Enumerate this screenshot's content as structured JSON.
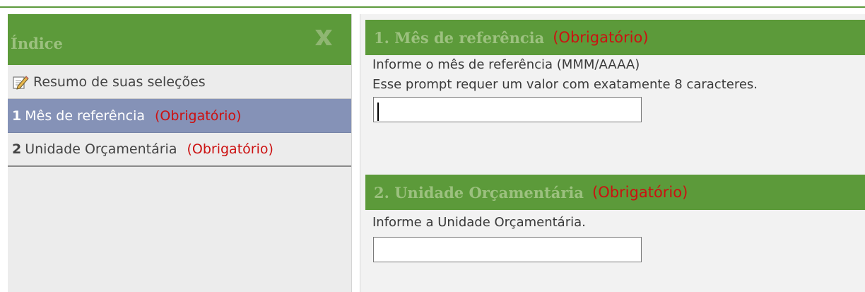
{
  "sidebar": {
    "title": "Índice",
    "close_icon": "close-x-icon",
    "items": [
      {
        "icon": "edit-icon",
        "label": "Resumo de suas seleções"
      },
      {
        "number": "1",
        "label": "Mês de referência",
        "required": "(Obrigatório)",
        "selected": true
      },
      {
        "number": "2",
        "label": "Unidade Orçamentária",
        "required": "(Obrigatório)"
      }
    ]
  },
  "main": {
    "sections": [
      {
        "title": "1. Mês de referência",
        "required": "(Obrigatório)",
        "descriptions": [
          "Informe o mês de referência (MMM/AAAA)",
          "Esse prompt requer um valor com exatamente 8 caracteres."
        ],
        "input_value": ""
      },
      {
        "title": "2. Unidade Orçamentária",
        "required": "(Obrigatório)",
        "descriptions": [
          "Informe a Unidade Orçamentária."
        ],
        "input_value": ""
      }
    ]
  },
  "colors": {
    "header_green": "#5c9a3a",
    "header_text": "#9cc17f",
    "selected_item": "#8592b7",
    "required_red": "#cc1111"
  }
}
